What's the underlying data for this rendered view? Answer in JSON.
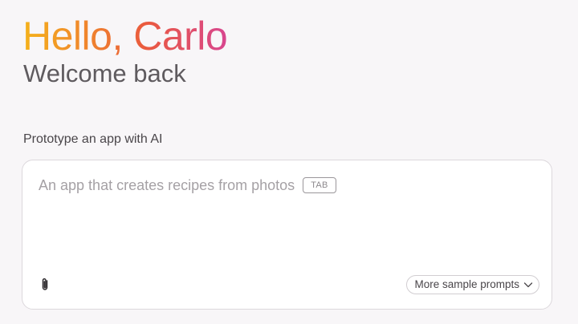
{
  "header": {
    "greeting": "Hello, Carlo",
    "subtitle": "Welcome back"
  },
  "prompt": {
    "section_label": "Prototype an app with AI",
    "placeholder": "An app that creates recipes from photos",
    "tab_hint": "TAB",
    "sample_prompts_label": "More sample prompts"
  },
  "icons": {
    "attach": "paperclip-icon",
    "dropdown": "chevron-down-icon"
  },
  "colors": {
    "greeting_gradient": [
      "#f5b21b",
      "#f08a2b",
      "#ea5a3e",
      "#d8468f"
    ],
    "background": "#f8f6f8"
  }
}
